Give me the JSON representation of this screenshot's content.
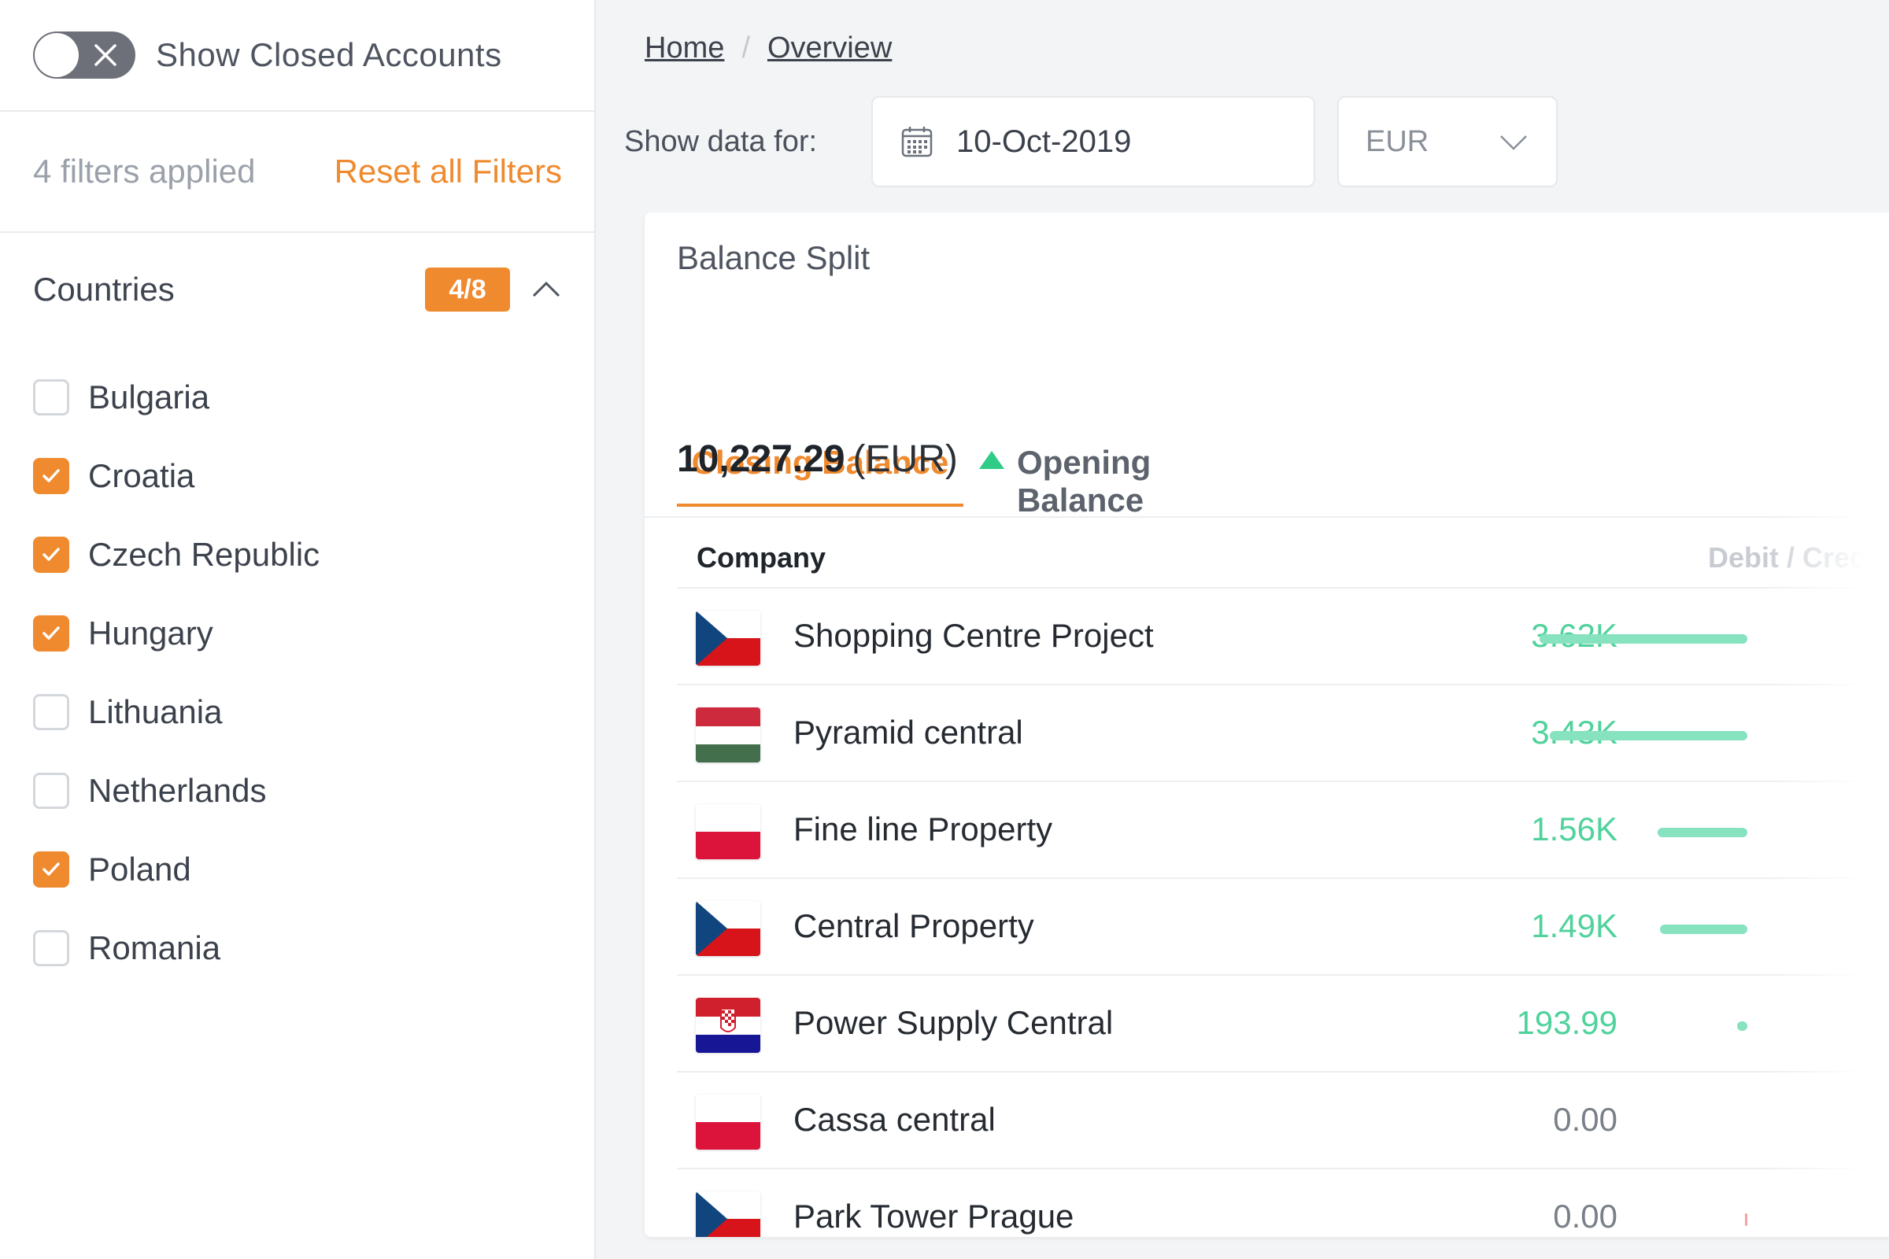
{
  "sidebar": {
    "toggle": {
      "label": "Show Closed Accounts",
      "on": false
    },
    "filters_count": "4 filters applied",
    "reset_label": "Reset all Filters",
    "countries": {
      "title": "Countries",
      "badge": "4/8",
      "items": [
        {
          "label": "Bulgaria",
          "checked": false
        },
        {
          "label": "Croatia",
          "checked": true
        },
        {
          "label": "Czech Republic",
          "checked": true
        },
        {
          "label": "Hungary",
          "checked": true
        },
        {
          "label": "Lithuania",
          "checked": false
        },
        {
          "label": "Netherlands",
          "checked": false
        },
        {
          "label": "Poland",
          "checked": true
        },
        {
          "label": "Romania",
          "checked": false
        }
      ]
    }
  },
  "main": {
    "breadcrumb": [
      "Home",
      "Overview"
    ],
    "show_data_label": "Show data for:",
    "date_value": "10-Oct-2019",
    "currency_value": "EUR",
    "card": {
      "title": "Balance Split",
      "tabs": [
        {
          "label": "Closing Balance",
          "active": true
        },
        {
          "label": "Opening Balance",
          "active": false
        }
      ],
      "balance_amount": "10,227.29",
      "balance_unit": "(EUR)",
      "table": {
        "col_company": "Company",
        "col_debit_credit": "Debit / Credit",
        "rows": [
          {
            "flag": "czech-flag",
            "company": "Shopping Centre Project",
            "value": "3.62K",
            "bar": 1.0
          },
          {
            "flag": "hungary-flag",
            "company": "Pyramid central",
            "value": "3.43K",
            "bar": 0.95
          },
          {
            "flag": "poland-flag",
            "company": "Fine line Property",
            "value": "1.56K",
            "bar": 0.43
          },
          {
            "flag": "czech-flag",
            "company": "Central Property",
            "value": "1.49K",
            "bar": 0.42
          },
          {
            "flag": "croatia-flag",
            "company": "Power Supply Central",
            "value": "193.99",
            "bar": 0.05
          },
          {
            "flag": "poland-flag",
            "company": "Cassa central",
            "value": "0.00",
            "bar": 0
          },
          {
            "flag": "czech-flag",
            "company": "Park Tower Prague",
            "value": "0.00",
            "bar": 0.01
          }
        ]
      }
    }
  },
  "colors": {
    "accent": "#f08a2e",
    "positive": "#4fd29b",
    "bar": "#86e2bf"
  }
}
